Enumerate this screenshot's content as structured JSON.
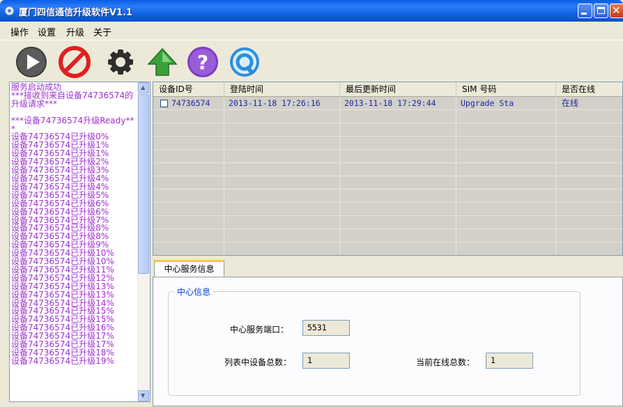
{
  "window": {
    "title": "厦门四信通信升级软件V1.1"
  },
  "menu": {
    "items": [
      "操作",
      "设置",
      "升级",
      "关于"
    ]
  },
  "toolbar": {
    "icons": [
      "play-icon",
      "stop-icon",
      "gear-icon",
      "upgrade-arrow-icon",
      "help-icon",
      "refresh-icon"
    ],
    "colors": {
      "play": "#555555",
      "stop": "#e02020",
      "gear": "#333333",
      "upgrade": "#3aa23a",
      "help": "#7b3fbf",
      "refresh": "#2a8fe0"
    }
  },
  "log": {
    "lines": [
      "服务启动成功",
      "***接收到来自设备74736574的升级请求***",
      "",
      "***设备74736574升级Ready***",
      "设备74736574已升级0%",
      "设备74736574已升级1%",
      "设备74736574已升级1%",
      "设备74736574已升级2%",
      "设备74736574已升级3%",
      "设备74736574已升级4%",
      "设备74736574已升级4%",
      "设备74736574已升级5%",
      "设备74736574已升级6%",
      "设备74736574已升级6%",
      "设备74736574已升级7%",
      "设备74736574已升级8%",
      "设备74736574已升级8%",
      "设备74736574已升级9%",
      "设备74736574已升级10%",
      "设备74736574已升级10%",
      "设备74736574已升级11%",
      "设备74736574已升级12%",
      "设备74736574已升级13%",
      "设备74736574已升级13%",
      "设备74736574已升级14%",
      "设备74736574已升级15%",
      "设备74736574已升级15%",
      "设备74736574已升级16%",
      "设备74736574已升级17%",
      "设备74736574已升级17%",
      "设备74736574已升级18%",
      "设备74736574已升级19%"
    ],
    "color": "#a030d0"
  },
  "table": {
    "columns": [
      "设备ID号",
      "登陆时间",
      "最后更新时间",
      "SIM 号码",
      "是否在线"
    ],
    "rows": [
      {
        "id": "74736574",
        "login": "2013-11-18 17:26:16",
        "updated": "2013-11-18 17:29:44",
        "sim": "Upgrade Sta",
        "online": "在线"
      }
    ]
  },
  "tabs": {
    "active": "中心服务信息"
  },
  "center": {
    "group_title": "中心信息",
    "port_label": "中心服务端口：",
    "port_value": "5531",
    "total_label": "列表中设备总数：",
    "total_value": "1",
    "online_label": "当前在线总数：",
    "online_value": "1"
  }
}
